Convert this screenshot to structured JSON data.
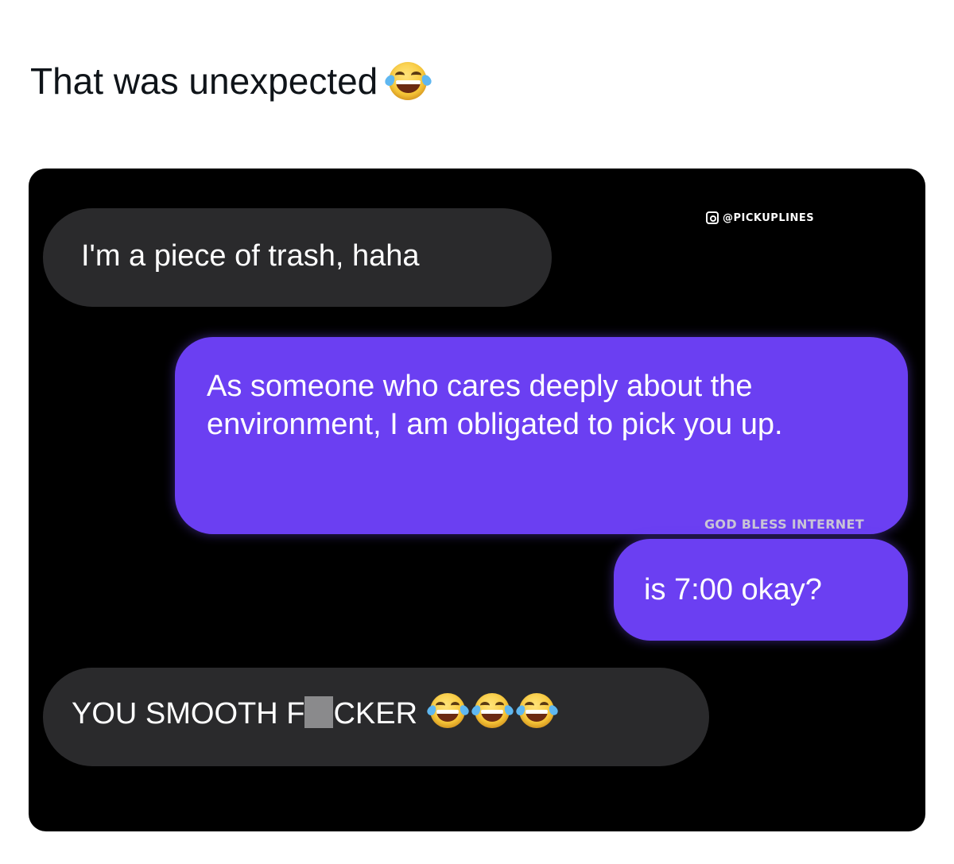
{
  "post": {
    "caption": "That was unexpected",
    "caption_emoji": "face-with-tears-of-joy"
  },
  "screenshot": {
    "watermark_top": "@PICKUPLINES",
    "watermark_mid": "GOD BLESS INTERNET",
    "messages": [
      {
        "side": "received",
        "text": "I'm a piece of trash, haha"
      },
      {
        "side": "sent",
        "text": "As someone who cares deeply about the environment, I am obligated to pick you up."
      },
      {
        "side": "sent",
        "text": "is 7:00 okay?"
      },
      {
        "side": "received",
        "text_before": "YOU SMOOTH F",
        "text_after": "CKER",
        "emojis": [
          "face-with-tears-of-joy",
          "face-with-tears-of-joy",
          "face-with-tears-of-joy"
        ]
      }
    ]
  },
  "colors": {
    "sent_bubble": "#6b3ff2",
    "received_bubble": "#2a2a2c",
    "background": "#000000"
  }
}
